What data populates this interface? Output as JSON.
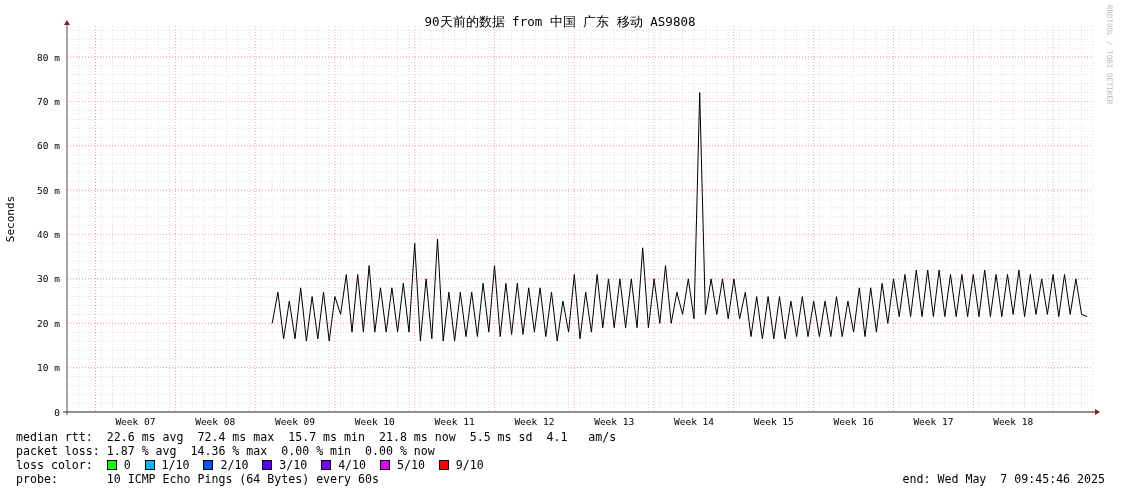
{
  "credit": "RRDTOOL / TOBI OETIKER",
  "chart_data": {
    "type": "line",
    "grid": true,
    "title": "90天前的数据 from 中国 广东 移动 AS9808",
    "ylabel": "Seconds",
    "ylim": [
      0,
      87
    ],
    "yticks": [
      {
        "value": 0,
        "label": "0"
      },
      {
        "value": 10,
        "label": "10 m"
      },
      {
        "value": 20,
        "label": "20 m"
      },
      {
        "value": 30,
        "label": "30 m"
      },
      {
        "value": 40,
        "label": "40 m"
      },
      {
        "value": 50,
        "label": "50 m"
      },
      {
        "value": 60,
        "label": "60 m"
      },
      {
        "value": 70,
        "label": "70 m"
      },
      {
        "value": 80,
        "label": "80 m"
      }
    ],
    "categories": [
      null,
      null,
      null,
      null,
      null,
      null,
      null,
      null,
      null,
      null,
      null,
      null,
      "Week 07",
      null,
      null,
      null,
      null,
      null,
      null,
      null,
      null,
      null,
      null,
      null,
      null,
      null,
      "Week 08",
      null,
      null,
      null,
      null,
      null,
      null,
      null,
      null,
      null,
      null,
      null,
      null,
      null,
      "Week 09",
      null,
      null,
      null,
      null,
      null,
      null,
      null,
      null,
      null,
      null,
      null,
      null,
      null,
      "Week 10",
      null,
      null,
      null,
      null,
      null,
      null,
      null,
      null,
      null,
      null,
      null,
      null,
      null,
      "Week 11",
      null,
      null,
      null,
      null,
      null,
      null,
      null,
      null,
      null,
      null,
      null,
      null,
      null,
      "Week 12",
      null,
      null,
      null,
      null,
      null,
      null,
      null,
      null,
      null,
      null,
      null,
      null,
      null,
      "Week 13",
      null,
      null,
      null,
      null,
      null,
      null,
      null,
      null,
      null,
      null,
      null,
      null,
      null,
      "Week 14",
      null,
      null,
      null,
      null,
      null,
      null,
      null,
      null,
      null,
      null,
      null,
      null,
      null,
      "Week 15",
      null,
      null,
      null,
      null,
      null,
      null,
      null,
      null,
      null,
      null,
      null,
      null,
      null,
      "Week 16",
      null,
      null,
      null,
      null,
      null,
      null,
      null,
      null,
      null,
      null,
      null,
      null,
      null,
      "Week 17",
      null,
      null,
      null,
      null,
      null,
      null,
      null,
      null,
      null,
      null,
      null,
      null,
      null,
      "Week 18",
      null,
      null,
      null,
      null,
      null,
      null,
      null,
      null,
      null,
      null,
      null,
      null,
      null
    ],
    "series": [
      {
        "color": "#000000",
        "values": [
          null,
          null,
          null,
          null,
          null,
          null,
          null,
          null,
          null,
          null,
          null,
          null,
          null,
          null,
          null,
          null,
          null,
          null,
          null,
          null,
          null,
          null,
          null,
          null,
          null,
          null,
          null,
          null,
          null,
          null,
          null,
          null,
          null,
          null,
          null,
          null,
          20,
          27,
          16.5,
          25,
          16.5,
          28,
          16,
          26,
          16.5,
          27,
          16,
          26,
          22,
          31,
          18,
          31,
          18,
          33,
          18,
          28,
          18,
          28,
          18,
          29,
          18,
          38,
          16,
          30,
          16.5,
          39,
          16,
          27,
          16,
          27,
          17,
          27,
          17,
          29,
          18,
          33,
          17,
          29,
          17.5,
          29,
          17.5,
          28,
          18,
          28,
          17,
          27,
          16,
          25,
          18,
          31,
          16.5,
          27,
          18,
          31,
          19,
          30,
          19,
          30,
          19,
          30,
          19,
          37,
          19,
          30,
          20,
          33,
          20,
          27,
          22,
          30,
          21,
          72,
          22,
          30,
          22,
          30,
          21,
          30,
          21,
          27,
          17,
          26,
          16.5,
          26,
          16.5,
          26,
          16.5,
          25,
          17,
          26,
          17,
          25,
          17,
          25,
          17,
          26,
          17,
          25,
          18,
          28,
          17,
          28,
          18,
          29,
          20,
          30,
          21.5,
          31,
          21.5,
          32,
          21.5,
          32,
          21.5,
          32,
          21.5,
          31,
          21.5,
          31,
          21.5,
          31,
          21.5,
          32,
          21.5,
          31,
          21.5,
          31,
          22,
          32,
          21.5,
          31,
          22,
          30,
          22,
          31,
          21.5,
          31,
          22,
          30,
          22,
          21.5
        ]
      }
    ]
  },
  "stats": [
    {
      "label": "median rtt:",
      "text": "22.6 ms avg  72.4 ms max  15.7 ms min  21.8 ms now  5.5 ms sd  4.1   am/s"
    },
    {
      "label": "packet loss:",
      "text": "1.87 % avg  14.36 % max  0.00 % min  0.00 % now"
    }
  ],
  "loss_color": {
    "label": "loss color:",
    "items": [
      {
        "label": "0",
        "color": "#00ff00"
      },
      {
        "label": "1/10",
        "color": "#00b8ff"
      },
      {
        "label": "2/10",
        "color": "#0059ff"
      },
      {
        "label": "3/10",
        "color": "#5e00ff"
      },
      {
        "label": "4/10",
        "color": "#7e00ff"
      },
      {
        "label": "5/10",
        "color": "#dd00ff"
      },
      {
        "label": "9/10",
        "color": "#ff0000"
      }
    ]
  },
  "probe": {
    "label": "probe:",
    "text": "10 ICMP Echo Pings (64 Bytes) every 60s"
  },
  "end": "end: Wed May  7 09:45:46 2025"
}
